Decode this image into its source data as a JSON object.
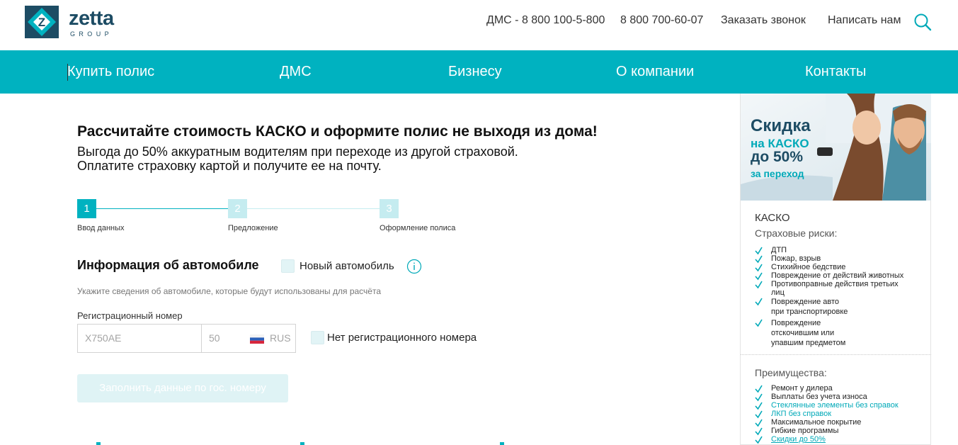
{
  "header": {
    "logo_word": "zetta",
    "logo_sub": "GROUP",
    "links": [
      {
        "label": "ДМС - 8 800 100-5-800"
      },
      {
        "label": "8 800 700-60-07"
      },
      {
        "label": "Заказать звонок"
      },
      {
        "label": "Написать нам"
      }
    ],
    "search_icon": "search-icon"
  },
  "nav": {
    "items": [
      {
        "label": "Купить полис"
      },
      {
        "label": "ДМС"
      },
      {
        "label": "Бизнесу"
      },
      {
        "label": "О компании"
      },
      {
        "label": "Контакты"
      }
    ]
  },
  "main": {
    "title": "Рассчитайте стоимость КАСКО и оформите полис не выходя из дома!",
    "subtitle_line1": "Выгода до 50% аккуратным водителям при переходе из другой страховой.",
    "subtitle_line2": "Оплатите страховку картой и получите ее на почту.",
    "steps": [
      {
        "num": "1",
        "label": "Ввод данных",
        "active": true
      },
      {
        "num": "2",
        "label": "Предложение",
        "active": false
      },
      {
        "num": "3",
        "label": "Оформление полиса",
        "active": false
      }
    ],
    "section_title": "Информация об автомобиле",
    "new_car_label": "Новый автомобиль",
    "hint": "Укажите сведения об автомобиле, которые будут использованы для расчёта",
    "reg_label": "Регистрационный номер",
    "reg_number_placeholder": "Х750АЕ",
    "reg_region_placeholder": "50",
    "reg_country": "RUS",
    "no_reg_label": "Нет регистрационного номера",
    "fill_button": "Заполнить данные по гос. номеру"
  },
  "sidebar": {
    "banner": {
      "line1": "Скидка",
      "line2": "на КАСКО",
      "line3": "до 50%",
      "line4": "за переход"
    },
    "title": "КАСКО",
    "risks_heading": "Страховые риски:",
    "risks": [
      "ДТП",
      "Пожар, взрыв",
      "Стихийное бедствие",
      "Повреждение от действий животных",
      "Противоправные действия третьих лиц",
      "Повреждение авто при транспортировке",
      "Повреждение отскочившим или упавшим предметом"
    ],
    "benefits_heading": "Преимущества:",
    "benefits": [
      {
        "text": "Ремонт у дилера",
        "style": "plain"
      },
      {
        "text": "Выплаты без учета износа",
        "style": "plain"
      },
      {
        "text": "Стеклянные элементы без справок",
        "style": "link"
      },
      {
        "text": "ЛКП без справок",
        "style": "link"
      },
      {
        "text": "Максимальное покрытие",
        "style": "plain"
      },
      {
        "text": "Гибкие программы",
        "style": "plain"
      },
      {
        "text": "Скидки до 50%",
        "style": "underline"
      }
    ]
  },
  "colors": {
    "brand_teal": "#00b2c0",
    "brand_navy": "#1d4c64",
    "step_inactive": "#c5ecf0"
  }
}
